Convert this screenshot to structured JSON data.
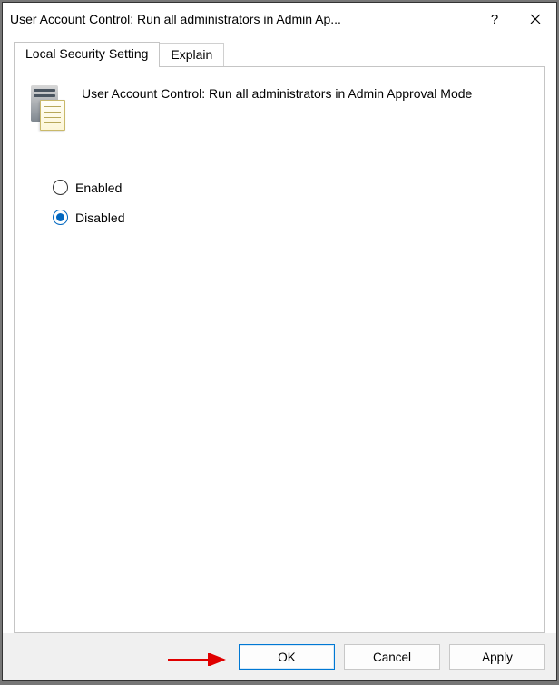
{
  "window": {
    "title": "User Account Control: Run all administrators in Admin Ap..."
  },
  "tabs": {
    "local_security": "Local Security Setting",
    "explain": "Explain"
  },
  "policy": {
    "title": "User Account Control: Run all administrators in Admin Approval Mode"
  },
  "options": {
    "enabled": "Enabled",
    "disabled": "Disabled",
    "selected": "disabled"
  },
  "buttons": {
    "ok": "OK",
    "cancel": "Cancel",
    "apply": "Apply"
  }
}
